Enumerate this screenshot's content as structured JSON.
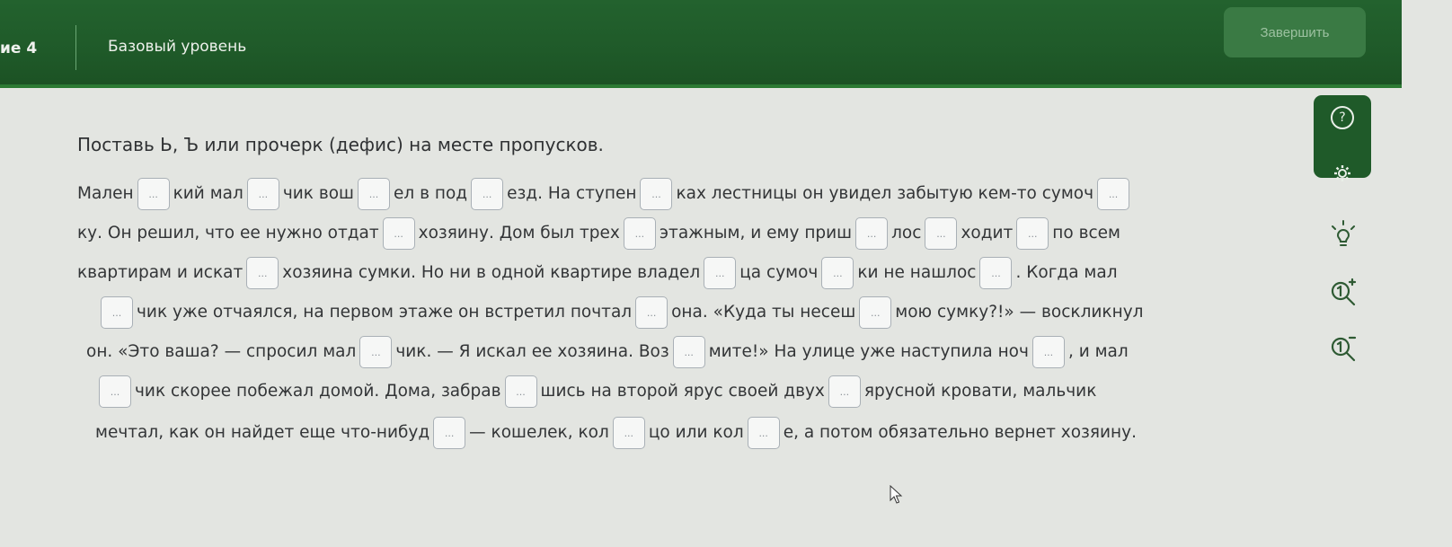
{
  "header": {
    "task_number": "ие 4",
    "level": "Базовый уровень",
    "finish_label": "Завершить"
  },
  "side_tools": {
    "help_icon": "?",
    "settings_icon": "gear-icon"
  },
  "colors": {
    "header_bg": "#1f5a29",
    "page_bg": "#e3e5e1",
    "blank_border": "#a9b0b6"
  },
  "exercise": {
    "instruction": "Поставь Ь, Ъ или прочерк (дефис) на месте пропусков.",
    "blank_placeholder": "...",
    "lines": [
      [
        "Мален",
        "кий мал",
        "чик вош",
        "ел в под",
        "езд. На ступен",
        "ках лестницы он увидел забытую кем-то сумоч",
        ""
      ],
      [
        "ку. Он решил, что ее нужно отдат",
        "хозяину. Дом был трех",
        "этажным, и ему приш",
        "лос",
        "ходит",
        "по всем"
      ],
      [
        "квартирам и искат",
        "хозяина сумки. Но ни в одной квартире владел",
        "ца сумоч",
        "ки не нашлос",
        ". Когда мал"
      ],
      [
        "",
        "чик уже отчаялся, на первом этаже он встретил почтал",
        "она. «Куда ты несеш",
        "мою сумку?!» — воскликнул"
      ],
      [
        "он. «Это ваша? — спросил мал",
        "чик. — Я искал ее хозяина. Воз",
        "мите!» На улице уже наступила ноч",
        ", и мал"
      ],
      [
        "",
        "чик скорее побежал домой. Дома, забрав",
        "шись на второй ярус своей двух",
        "ярусной кровати, мальчик"
      ],
      [
        "мечтал, как он найдет еще что-нибуд",
        "— кошелек, кол",
        "цо или кол",
        "е, а потом обязательно вернет хозяину."
      ]
    ]
  }
}
